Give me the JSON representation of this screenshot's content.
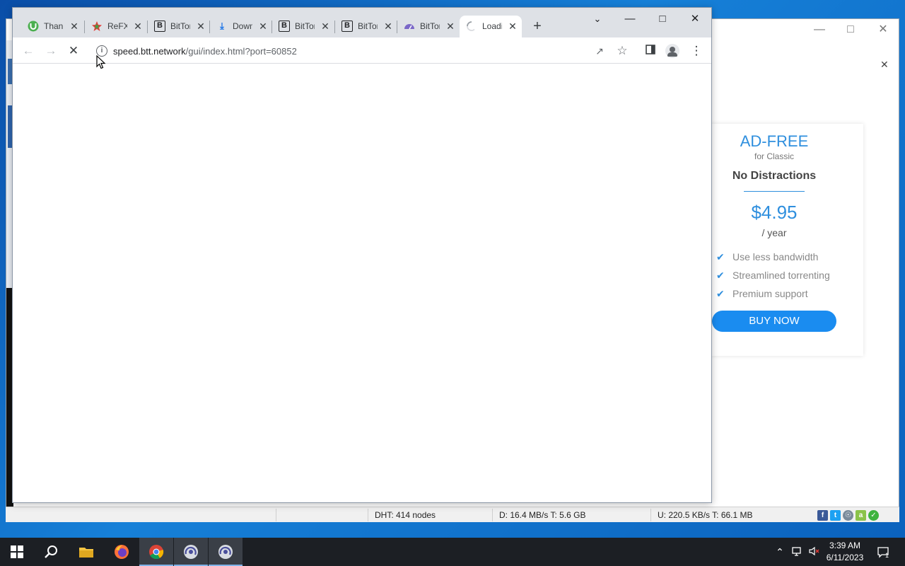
{
  "chrome": {
    "tabs": [
      {
        "title": "Thank",
        "favicon": "utorrent-icon",
        "favicon_color": "#4caf50"
      },
      {
        "title": "ReFX",
        "favicon": "refx-icon",
        "favicon_color": "#e53935"
      },
      {
        "title": "BitTorrent",
        "favicon": "bittorrent-b-icon",
        "favicon_color": "#202124"
      },
      {
        "title": "Download",
        "favicon": "download-icon",
        "favicon_color": "#1a73e8"
      },
      {
        "title": "BitTorrent",
        "favicon": "bittorrent-b-icon",
        "favicon_color": "#202124"
      },
      {
        "title": "BitTorrent",
        "favicon": "bittorrent-b-icon",
        "favicon_color": "#202124"
      },
      {
        "title": "BitTorrent",
        "favicon": "btt-speed-icon",
        "favicon_color": "#7b68c8"
      },
      {
        "title": "Loading",
        "favicon": "loading-spinner-icon",
        "favicon_color": "#9aa0a6"
      }
    ],
    "new_tab_label": "+",
    "url": {
      "host": "speed.btt.network",
      "path": "/gui/index.html?port=60852"
    }
  },
  "ad": {
    "title": "AD-FREE",
    "subtitle": "for Classic",
    "headline": "No Distractions",
    "price": "$4.95",
    "period": "/ year",
    "features": [
      "Use less bandwidth",
      "Streamlined torrenting",
      "Premium support"
    ],
    "buy_label": "BUY NOW",
    "accent": "#2f8fde",
    "button_color": "#1a8cf0"
  },
  "statusbar": {
    "dht": "DHT: 414 nodes",
    "download": "D: 16.4 MB/s T: 5.6 GB",
    "upload": "U: 220.5 KB/s T: 66.1 MB"
  },
  "taskbar": {
    "apps": [
      "windows-start-icon",
      "search-icon",
      "file-explorer-icon",
      "firefox-icon",
      "chrome-icon",
      "bittorrent-icon",
      "bittorrent-icon"
    ],
    "time": "3:39 AM",
    "date": "6/11/2023",
    "notification_count": "1"
  }
}
